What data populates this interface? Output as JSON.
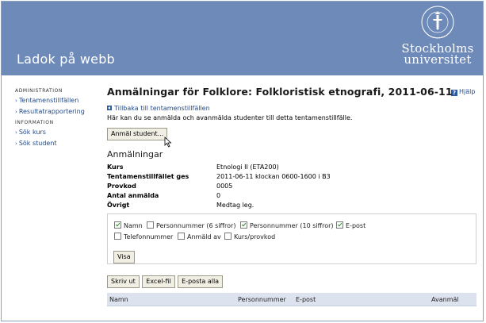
{
  "header": {
    "app_title": "Ladok på webb",
    "logo_line1": "Stockholms",
    "logo_line2": "universitet"
  },
  "sidebar": {
    "sections": [
      {
        "heading": "ADMINISTRATION",
        "items": [
          "Tentamenstillfällen",
          "Resultatrapportering"
        ]
      },
      {
        "heading": "INFORMATION",
        "items": [
          "Sök kurs",
          "Sök student"
        ]
      }
    ]
  },
  "help_label": "Hjälp",
  "main": {
    "title": "Anmälningar för Folklore: Folkloristisk etnografi, 2011-06-11",
    "back_link": "Tillbaka till tentamenstillfällen",
    "intro": "Här kan du se anmälda och avanmälda studenter till detta tentamenstillfälle.",
    "register_button": "Anmäl student...",
    "section_title": "Anmälningar",
    "info": [
      {
        "label": "Kurs",
        "value": "Etnologi II (ETA200)"
      },
      {
        "label": "Tentamenstillfället ges",
        "value": "2011-06-11 klockan 0600-1600 i B3"
      },
      {
        "label": "Provkod",
        "value": "0005"
      },
      {
        "label": "Antal anmälda",
        "value": "0"
      },
      {
        "label": "Övrigt",
        "value": "Medtag leg."
      }
    ],
    "filters": [
      {
        "label": "Namn",
        "checked": true
      },
      {
        "label": "Personnummer (6 siffror)",
        "checked": false
      },
      {
        "label": "Personnummer (10 siffror)",
        "checked": true
      },
      {
        "label": "E-post",
        "checked": true
      },
      {
        "label": "Telefonnummer",
        "checked": false
      },
      {
        "label": "Anmäld av",
        "checked": false
      },
      {
        "label": "Kurs/provkod",
        "checked": false
      }
    ],
    "show_button": "Visa",
    "actions": [
      "Skriv ut",
      "Excel-fil",
      "E-posta alla"
    ],
    "columns": [
      "Namn",
      "Personnummer",
      "E-post",
      "Avanmäl"
    ]
  }
}
